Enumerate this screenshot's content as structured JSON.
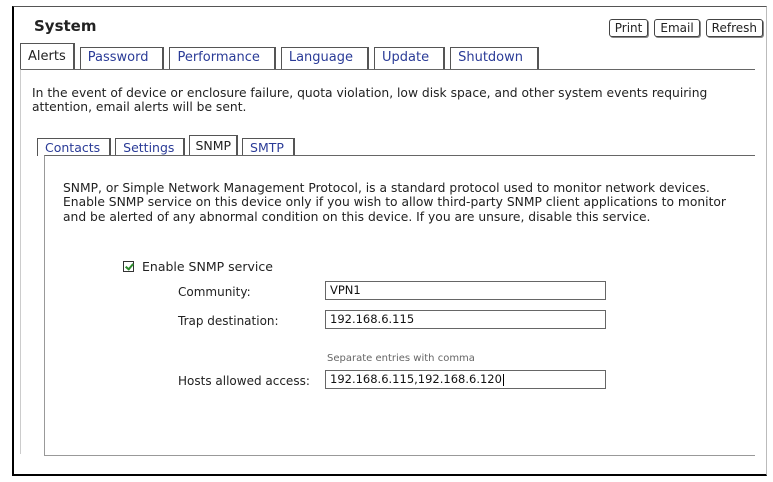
{
  "header": {
    "title": "System",
    "buttons": {
      "print": "Print",
      "email": "Email",
      "refresh": "Refresh"
    }
  },
  "main_tabs": [
    {
      "label": "Alerts",
      "active": true
    },
    {
      "label": "Password",
      "active": false
    },
    {
      "label": "Performance",
      "active": false
    },
    {
      "label": "Language",
      "active": false
    },
    {
      "label": "Update",
      "active": false
    },
    {
      "label": "Shutdown",
      "active": false
    }
  ],
  "alerts": {
    "description": "In the event of device or enclosure failure, quota violation, low disk space, and other system events requiring attention, email alerts will be sent."
  },
  "sub_tabs": [
    {
      "label": "Contacts",
      "active": false
    },
    {
      "label": "Settings",
      "active": false
    },
    {
      "label": "SNMP",
      "active": true
    },
    {
      "label": "SMTP",
      "active": false
    }
  ],
  "snmp": {
    "description": "SNMP, or Simple Network Management Protocol, is a standard protocol used to monitor network devices. Enable SNMP service on this device only if you wish to allow third-party SNMP client applications to monitor and be alerted of any abnormal condition on this device. If you are unsure, disable this service.",
    "enable_label": "Enable SNMP service",
    "enabled": true,
    "community_label": "Community:",
    "community_value": "VPN1",
    "trap_label": "Trap destination:",
    "trap_value": "192.168.6.115",
    "hosts_hint": "Separate entries with comma",
    "hosts_label": "Hosts allowed access:",
    "hosts_value": "192.168.6.115,192.168.6.120"
  },
  "colors": {
    "tab_link": "#2a3b97",
    "check": "#2d8a2d"
  }
}
